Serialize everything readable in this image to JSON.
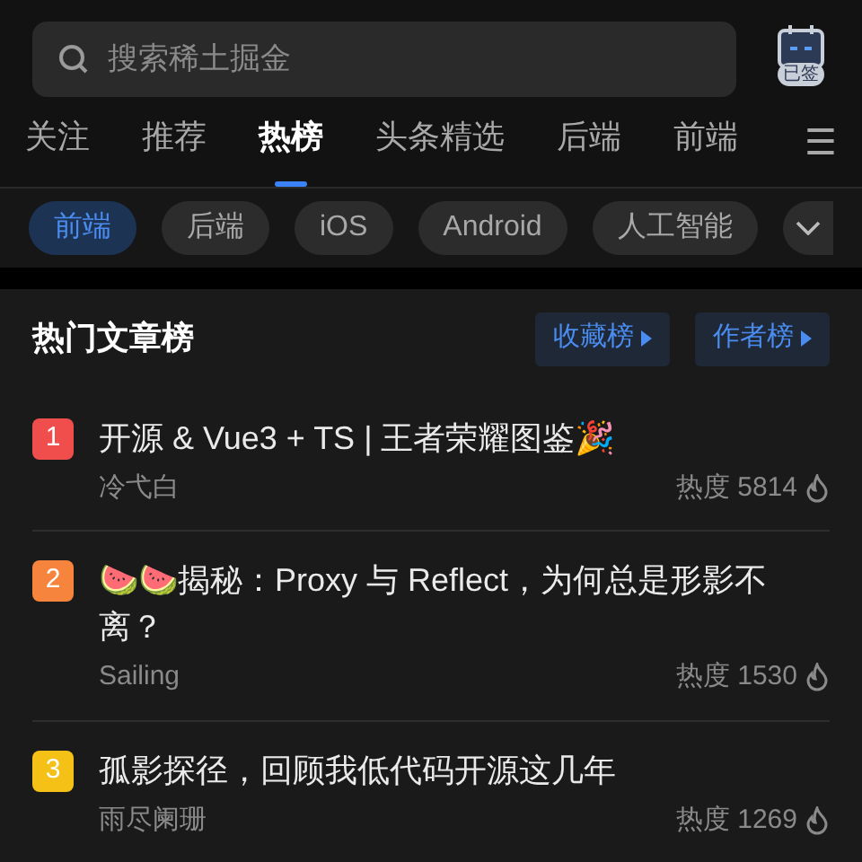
{
  "search": {
    "placeholder": "搜索稀土掘金"
  },
  "checkin": {
    "label": "已签"
  },
  "tabs": [
    {
      "label": "关注",
      "selected": false
    },
    {
      "label": "推荐",
      "selected": false
    },
    {
      "label": "热榜",
      "selected": true
    },
    {
      "label": "头条精选",
      "selected": false
    },
    {
      "label": "后端",
      "selected": false
    },
    {
      "label": "前端",
      "selected": false
    }
  ],
  "menu_glyph": "☰",
  "chips": [
    {
      "label": "前端",
      "selected": true
    },
    {
      "label": "后端",
      "selected": false
    },
    {
      "label": "iOS",
      "selected": false
    },
    {
      "label": "Android",
      "selected": false
    },
    {
      "label": "人工智能",
      "selected": false
    }
  ],
  "panel": {
    "title": "热门文章榜",
    "links": [
      "收藏榜",
      "作者榜"
    ]
  },
  "articles": [
    {
      "rank": "1",
      "color": "#f04d4d",
      "title": "开源 & Vue3 + TS | 王者荣耀图鉴🎉",
      "author": "冷弋白",
      "heat": "热度 5814"
    },
    {
      "rank": "2",
      "color": "#f6843c",
      "title": "🍉🍉揭秘：Proxy 与 Reflect，为何总是形影不离？",
      "author": "Sailing",
      "heat": "热度 1530"
    },
    {
      "rank": "3",
      "color": "#f5c117",
      "title": "孤影探径，回顾我低代码开源这几年",
      "author": "雨尽阑珊",
      "heat": "热度 1269"
    }
  ]
}
